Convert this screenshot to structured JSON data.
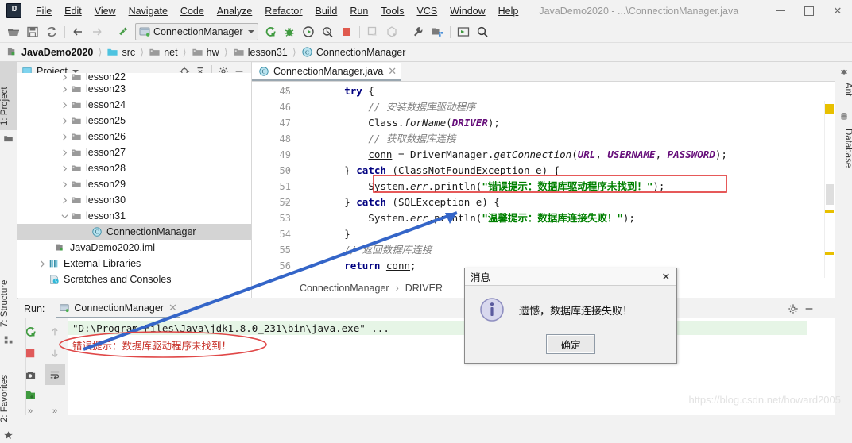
{
  "window": {
    "title": "JavaDemo2020 - ...\\ConnectionManager.java",
    "minimize": "—",
    "maximize": "□",
    "close": "✕"
  },
  "menu": [
    {
      "label": "File"
    },
    {
      "label": "Edit"
    },
    {
      "label": "View"
    },
    {
      "label": "Navigate"
    },
    {
      "label": "Code"
    },
    {
      "label": "Analyze"
    },
    {
      "label": "Refactor"
    },
    {
      "label": "Build"
    },
    {
      "label": "Run"
    },
    {
      "label": "Tools"
    },
    {
      "label": "VCS"
    },
    {
      "label": "Window"
    },
    {
      "label": "Help"
    }
  ],
  "toolbar": {
    "run_config": "ConnectionManager",
    "icons": [
      "open-folder-icon",
      "save-all-icon",
      "sync-icon",
      "back-arrow-icon",
      "forward-arrow-icon",
      "build-hammer-icon",
      "run-icon",
      "debug-icon",
      "run-with-coverage-icon",
      "profile-icon",
      "stop-icon",
      "update-project-icon",
      "commit-icon",
      "settings-wrench-icon",
      "project-structure-icon",
      "select-in-icon",
      "search-everywhere-icon"
    ]
  },
  "breadcrumb": [
    {
      "label": "JavaDemo2020",
      "icon": "module-icon",
      "bold": true
    },
    {
      "label": "src",
      "icon": "source-folder-icon",
      "bold": false
    },
    {
      "label": "net",
      "icon": "folder-icon",
      "bold": false
    },
    {
      "label": "hw",
      "icon": "folder-icon",
      "bold": false
    },
    {
      "label": "lesson31",
      "icon": "folder-icon",
      "bold": false
    },
    {
      "label": "ConnectionManager",
      "icon": "class-icon",
      "bold": false
    }
  ],
  "left_strip": [
    {
      "label": "1: Project",
      "active": true
    },
    {
      "label": "7: Structure",
      "active": false
    },
    {
      "label": "2: Favorites",
      "active": false
    }
  ],
  "right_strip": [
    {
      "label": "Ant"
    },
    {
      "label": "Database"
    }
  ],
  "project_panel": {
    "title": "Project",
    "header_icons": [
      "locate-icon",
      "collapse-all-icon",
      "gear-icon",
      "hide-icon"
    ],
    "tree": [
      {
        "label": "lesson22",
        "icon": "folder-icon",
        "twist": "right",
        "indent": 3,
        "partial": true
      },
      {
        "label": "lesson23",
        "icon": "folder-icon",
        "twist": "right",
        "indent": 3
      },
      {
        "label": "lesson24",
        "icon": "folder-icon",
        "twist": "right",
        "indent": 3
      },
      {
        "label": "lesson25",
        "icon": "folder-icon",
        "twist": "right",
        "indent": 3
      },
      {
        "label": "lesson26",
        "icon": "folder-icon",
        "twist": "right",
        "indent": 3
      },
      {
        "label": "lesson27",
        "icon": "folder-icon",
        "twist": "right",
        "indent": 3
      },
      {
        "label": "lesson28",
        "icon": "folder-icon",
        "twist": "right",
        "indent": 3
      },
      {
        "label": "lesson29",
        "icon": "folder-icon",
        "twist": "right",
        "indent": 3
      },
      {
        "label": "lesson30",
        "icon": "folder-icon",
        "twist": "right",
        "indent": 3
      },
      {
        "label": "lesson31",
        "icon": "folder-icon",
        "twist": "down",
        "indent": 3
      },
      {
        "label": "ConnectionManager",
        "icon": "class-icon",
        "twist": "none",
        "indent": 5,
        "selected": true
      },
      {
        "label": "JavaDemo2020.iml",
        "icon": "module-file-icon",
        "twist": "none",
        "indent": 2
      },
      {
        "label": "External Libraries",
        "icon": "libraries-icon",
        "twist": "right",
        "indent": 1
      },
      {
        "label": "Scratches and Consoles",
        "icon": "scratches-icon",
        "twist": "none",
        "indent": 1
      }
    ]
  },
  "editor": {
    "tab": {
      "label": "ConnectionManager.java",
      "icon": "class-icon",
      "close": "✕"
    },
    "first_line_number": 45,
    "lines": [
      {
        "n": 45,
        "html": "        <span class='kw'>try</span> {"
      },
      {
        "n": 46,
        "html": "            <span class='cm'>// 安装数据库驱动程序</span>"
      },
      {
        "n": 47,
        "html": "            Class.<span class='mth'>forName</span>(<span class='fld'>DRIVER</span>);"
      },
      {
        "n": 48,
        "html": "            <span class='cm'>// 获取数据库连接</span>"
      },
      {
        "n": 49,
        "html": "            <span class='uline'>conn</span> = DriverManager.<span class='mth'>getConnection</span>(<span class='fld'>URL</span>, <span class='fld'>USERNAME</span>, <span class='fld'>PASSWORD</span>);"
      },
      {
        "n": 50,
        "html": "        } <span class='kw'>catch</span> (ClassNotFoundException e) {"
      },
      {
        "n": 51,
        "html": "            System.<span class='mth'>err</span>.println(<span class='st'>\"错误提示：数据库驱动程序未找到！\"</span>);"
      },
      {
        "n": 52,
        "html": "        } <span class='kw'>catch</span> (SQLException e) {"
      },
      {
        "n": 53,
        "html": "            System.<span class='mth'>err</span>.println(<span class='st'>\"温馨提示：数据库连接失败！\"</span>);"
      },
      {
        "n": 54,
        "html": "        }"
      },
      {
        "n": 55,
        "html": "        <span class='cm'>// 返回数据库连接</span>"
      },
      {
        "n": 56,
        "html": "        <span class='kw'>return</span> <span class='uline'>conn</span>;"
      }
    ],
    "status_breadcrumb": [
      "ConnectionManager",
      "DRIVER"
    ],
    "status_separator": "›"
  },
  "run_panel": {
    "label": "Run:",
    "tab": {
      "label": "ConnectionManager",
      "icon": "run-config-icon",
      "close": "✕"
    },
    "side_buttons": [
      "rerun-icon",
      "stop-icon",
      "screenshot-icon",
      "export-icon",
      "expand-more-icon",
      "scroll-up-icon",
      "scroll-down-icon",
      "soft-wrap-icon",
      "expand-more-2-icon"
    ],
    "right_icons": [
      "gear-icon",
      "hide-icon"
    ],
    "console": {
      "command": "\"D:\\Program Files\\Java\\jdk1.8.0_231\\bin\\java.exe\" ...",
      "error_output": "错误提示：数据库驱动程序未找到！"
    }
  },
  "dialog": {
    "title": "消息",
    "close": "✕",
    "icon": "info-icon",
    "message": "遗憾，数据库连接失败！",
    "ok_button": "确定"
  },
  "watermark": "https://blog.csdn.net/howard2005",
  "colors": {
    "accent_blue": "#3465c8",
    "error_red": "#c8322a",
    "annotation_red": "#e04848",
    "string_green": "#008000",
    "keyword_navy": "#000080",
    "marker_yellow": "#e8c000"
  }
}
